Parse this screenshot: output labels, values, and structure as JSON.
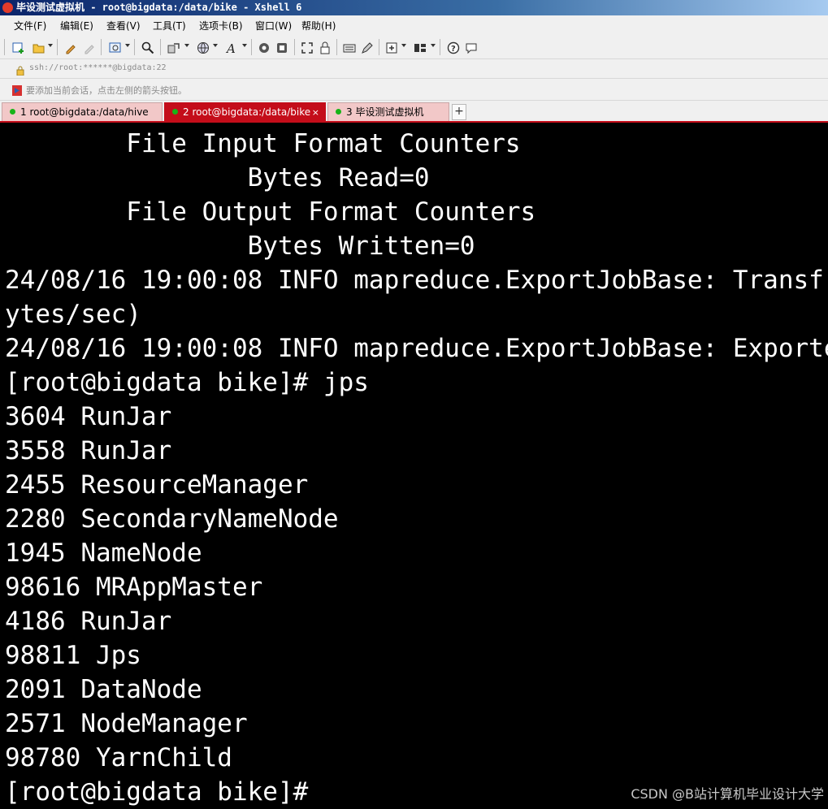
{
  "window": {
    "title": "毕设测试虚拟机 - root@bigdata:/data/bike - Xshell 6"
  },
  "menu": {
    "items": [
      "文件(F)",
      "编辑(E)",
      "查看(V)",
      "工具(T)",
      "选项卡(B)",
      "窗口(W)",
      "帮助(H)"
    ]
  },
  "address": {
    "value": "ssh://root:******@bigdata:22"
  },
  "hint": {
    "text": "要添加当前会话，点击左侧的箭头按钮。"
  },
  "tabs": [
    {
      "label": "1 root@bigdata:/data/hive",
      "active": false,
      "status_color": "#18b418"
    },
    {
      "label": "2 root@bigdata:/data/bike",
      "active": true,
      "status_color": "#18b418",
      "close": "×"
    },
    {
      "label": "3 毕设测试虚拟机",
      "active": false,
      "status_color": "#18b418"
    }
  ],
  "tab_add_label": "+",
  "terminal": {
    "background": "#000000",
    "foreground": "#ffffff",
    "lines": [
      "        File Input Format Counters",
      "                Bytes Read=0",
      "        File Output Format Counters",
      "                Bytes Written=0",
      "24/08/16 19:00:08 INFO mapreduce.ExportJobBase: Transf",
      "ytes/sec)",
      "24/08/16 19:00:08 INFO mapreduce.ExportJobBase: Exporte",
      "[root@bigdata bike]# jps",
      "3604 RunJar",
      "3558 RunJar",
      "2455 ResourceManager",
      "2280 SecondaryNameNode",
      "1945 NameNode",
      "98616 MRAppMaster",
      "4186 RunJar",
      "98811 Jps",
      "2091 DataNode",
      "2571 NodeManager",
      "98780 YarnChild",
      "[root@bigdata bike]#"
    ]
  },
  "watermark": "CSDN @B站计算机毕业设计大学",
  "colors": {
    "accent": "#c40d1a",
    "tab_inactive": "#f2c8c8",
    "status_green": "#18b418"
  }
}
